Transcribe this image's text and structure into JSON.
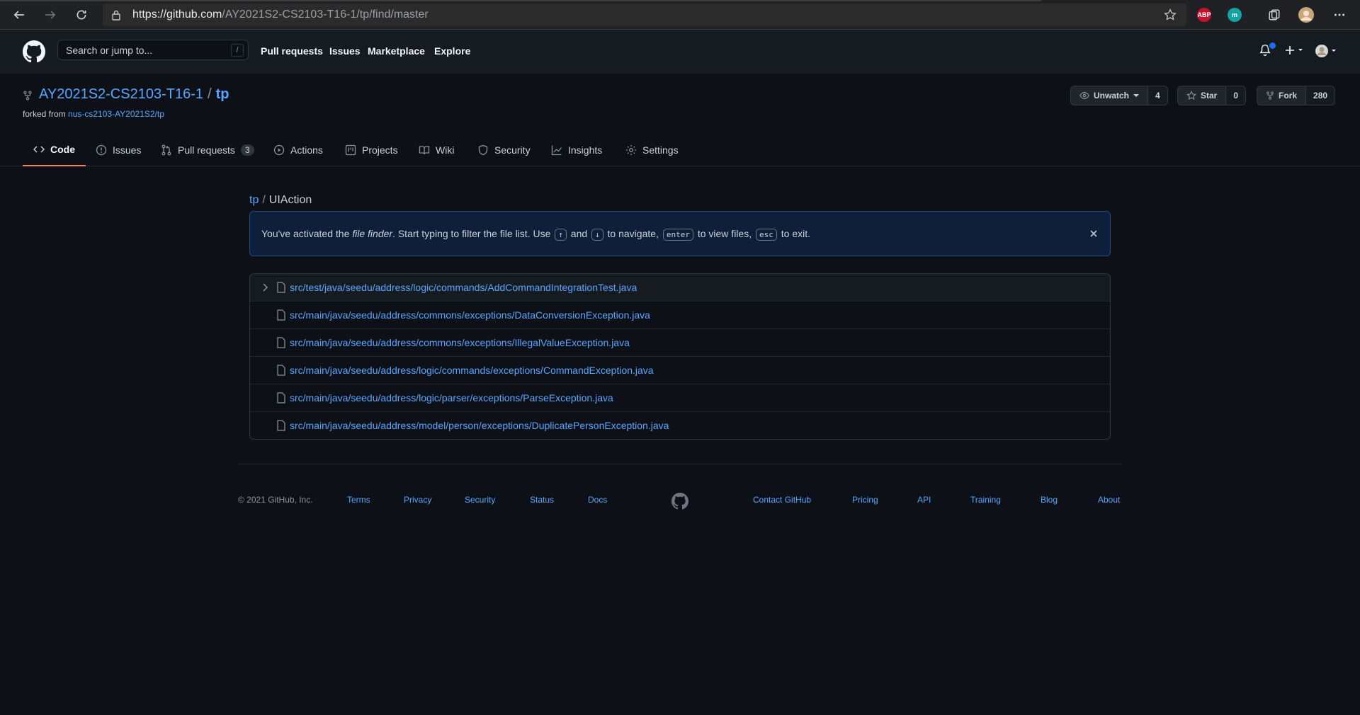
{
  "browser": {
    "url_host": "https://github.com",
    "url_path": "/AY2021S2-CS2103-T16-1/tp/find/master",
    "extensions": {
      "abp": "ABP",
      "m": "m"
    }
  },
  "header": {
    "search_placeholder": "Search or jump to...",
    "search_shortcut": "/",
    "nav": [
      "Pull requests",
      "Issues",
      "Marketplace",
      "Explore"
    ]
  },
  "repo": {
    "owner": "AY2021S2-CS2103-T16-1",
    "separator": "/",
    "name": "tp",
    "forked_from_label": "forked from",
    "forked_from": "nus-cs2103-AY2021S2/tp",
    "watch": {
      "label": "Unwatch",
      "count": "4"
    },
    "star": {
      "label": "Star",
      "count": "0"
    },
    "fork": {
      "label": "Fork",
      "count": "280"
    }
  },
  "tabs": {
    "code": "Code",
    "issues": "Issues",
    "pulls": "Pull requests",
    "pulls_count": "3",
    "actions": "Actions",
    "projects": "Projects",
    "wiki": "Wiki",
    "security": "Security",
    "insights": "Insights",
    "settings": "Settings"
  },
  "finder": {
    "crumb_repo": "tp",
    "crumb_sep": "/",
    "query": "UIAction",
    "flash": {
      "t1": "You've activated the ",
      "t2": "file finder",
      "t3": ". Start typing to filter the file list. Use ",
      "k_up": "↑",
      "t4": " and ",
      "k_down": "↓",
      "t5": " to navigate, ",
      "k_enter": "enter",
      "t6": " to view files, ",
      "k_esc": "esc",
      "t7": " to exit."
    },
    "results": [
      "src/test/java/seedu/address/logic/commands/AddCommandIntegrationTest.java",
      "src/main/java/seedu/address/commons/exceptions/DataConversionException.java",
      "src/main/java/seedu/address/commons/exceptions/IllegalValueException.java",
      "src/main/java/seedu/address/logic/commands/exceptions/CommandException.java",
      "src/main/java/seedu/address/logic/parser/exceptions/ParseException.java",
      "src/main/java/seedu/address/model/person/exceptions/DuplicatePersonException.java"
    ]
  },
  "footer": {
    "copyright": "© 2021 GitHub, Inc.",
    "left_links": [
      "Terms",
      "Privacy",
      "Security",
      "Status",
      "Docs"
    ],
    "right_links": [
      "Contact GitHub",
      "Pricing",
      "API",
      "Training",
      "Blog",
      "About"
    ]
  },
  "colors": {
    "background": "#0d1117",
    "link": "#58a6ff",
    "active_tab": "#f78166"
  }
}
